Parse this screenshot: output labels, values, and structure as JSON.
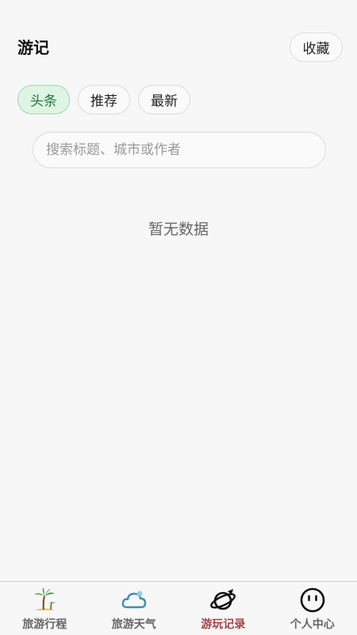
{
  "header": {
    "title": "游记",
    "favorites_label": "收藏"
  },
  "tabs": [
    {
      "label": "头条",
      "active": true
    },
    {
      "label": "推荐",
      "active": false
    },
    {
      "label": "最新",
      "active": false
    }
  ],
  "search": {
    "value": "",
    "placeholder": "搜索标题、城市或作者"
  },
  "main": {
    "empty_text": "暂无数据"
  },
  "tabbar": {
    "items": [
      {
        "label": "旅游行程",
        "icon": "palm-tree-icon",
        "active": false
      },
      {
        "label": "旅游天气",
        "icon": "cloud-icon",
        "active": false
      },
      {
        "label": "游玩记录",
        "icon": "planet-icon",
        "active": true
      },
      {
        "label": "个人中心",
        "icon": "smiley-icon",
        "active": false
      }
    ]
  },
  "colors": {
    "active_tab_bg": "#dff5e4",
    "active_tab_text": "#1f7a3a",
    "active_nav_label": "#a04545"
  }
}
